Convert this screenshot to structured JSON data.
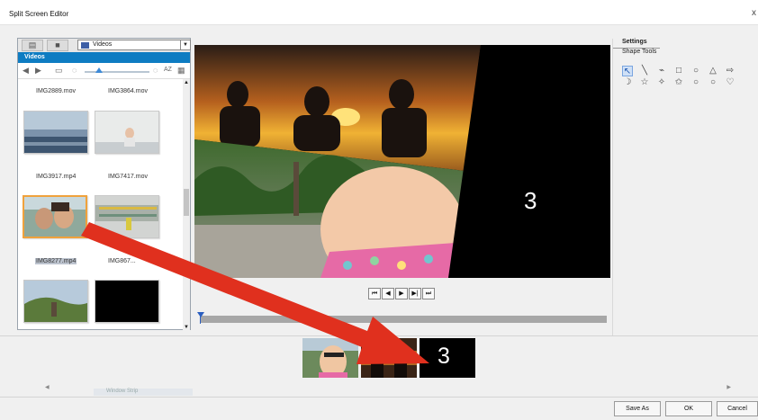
{
  "window": {
    "title": "Split Screen Editor",
    "close_glyph": "x"
  },
  "library": {
    "tab_icons": [
      "filmstrip-icon",
      "folder-icon"
    ],
    "folder_select": "Videos",
    "header": "Videos",
    "toolbar": {
      "sort_label": "AZ"
    },
    "labels": {
      "r1a": "IMG2889.mov",
      "r1b": "IMG3864.mov",
      "r2a": "IMG3917.mp4",
      "r2b": "IMG7417.mov",
      "r3a": "IMG8277.mp4",
      "r3b": "IMG867..."
    },
    "selected_item": "IMG8277.mp4"
  },
  "preview": {
    "overlay_number": "3"
  },
  "transport": {
    "buttons": [
      "⏮",
      "◀",
      "▶",
      "▶|",
      "⏭"
    ]
  },
  "settings": {
    "tab": "Settings",
    "subtitle": "Shape Tools",
    "row1": [
      "↖",
      "╲",
      "⌁",
      "□",
      "○",
      "△",
      "⇨"
    ],
    "row2": [
      "☽",
      "☆",
      "✧",
      "✩",
      "○",
      "○",
      "♡"
    ]
  },
  "strip": {
    "third_number": "3",
    "ghost_label": "Window Strip"
  },
  "footer": {
    "save_as": "Save As",
    "ok": "OK",
    "cancel": "Cancel"
  },
  "colors": {
    "accent": "#0e7cc2",
    "arrow": "#e0301e",
    "selection": "#f0a23c"
  }
}
